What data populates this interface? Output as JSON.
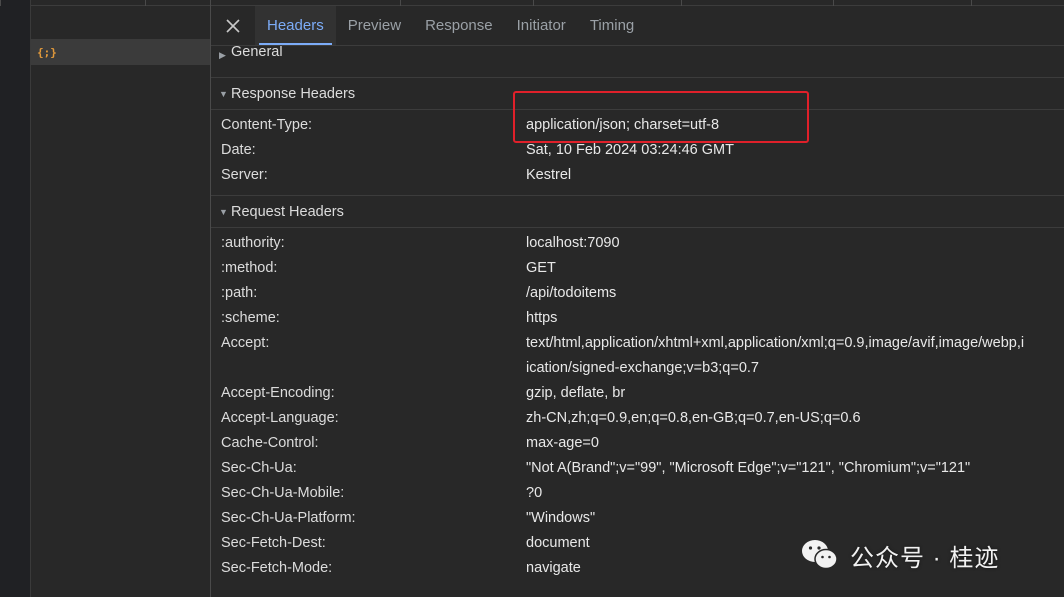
{
  "tabs": [
    {
      "label": "Headers",
      "active": true
    },
    {
      "label": "Preview",
      "active": false
    },
    {
      "label": "Response",
      "active": false
    },
    {
      "label": "Initiator",
      "active": false
    },
    {
      "label": "Timing",
      "active": false
    }
  ],
  "request_list": {
    "selected_icon": "{;}"
  },
  "sections": {
    "general": {
      "title": "General",
      "expanded": false
    },
    "response_headers": {
      "title": "Response Headers",
      "expanded": true,
      "rows": [
        {
          "name": "Content-Type:",
          "value": "application/json; charset=utf-8"
        },
        {
          "name": "Date:",
          "value": "Sat, 10 Feb 2024 03:24:46 GMT"
        },
        {
          "name": "Server:",
          "value": "Kestrel"
        }
      ]
    },
    "request_headers": {
      "title": "Request Headers",
      "expanded": true,
      "rows": [
        {
          "name": ":authority:",
          "value": "localhost:7090"
        },
        {
          "name": ":method:",
          "value": "GET"
        },
        {
          "name": ":path:",
          "value": "/api/todoitems"
        },
        {
          "name": ":scheme:",
          "value": "https"
        },
        {
          "name": "Accept:",
          "value": "text/html,application/xhtml+xml,application/xml;q=0.9,image/avif,image/webp,i"
        },
        {
          "name": "",
          "value": "ication/signed-exchange;v=b3;q=0.7"
        },
        {
          "name": "Accept-Encoding:",
          "value": "gzip, deflate, br"
        },
        {
          "name": "Accept-Language:",
          "value": "zh-CN,zh;q=0.9,en;q=0.8,en-GB;q=0.7,en-US;q=0.6"
        },
        {
          "name": "Cache-Control:",
          "value": "max-age=0"
        },
        {
          "name": "Sec-Ch-Ua:",
          "value": "\"Not A(Brand\";v=\"99\", \"Microsoft Edge\";v=\"121\", \"Chromium\";v=\"121\""
        },
        {
          "name": "Sec-Ch-Ua-Mobile:",
          "value": "?0"
        },
        {
          "name": "Sec-Ch-Ua-Platform:",
          "value": "\"Windows\""
        },
        {
          "name": "Sec-Fetch-Dest:",
          "value": "document"
        },
        {
          "name": "Sec-Fetch-Mode:",
          "value": "navigate"
        }
      ]
    }
  },
  "watermark": {
    "text": "公众号 · 桂迹"
  },
  "colors": {
    "accent": "#7cacf8",
    "highlight_box": "#e0202a",
    "json_icon": "#e39a3b"
  }
}
